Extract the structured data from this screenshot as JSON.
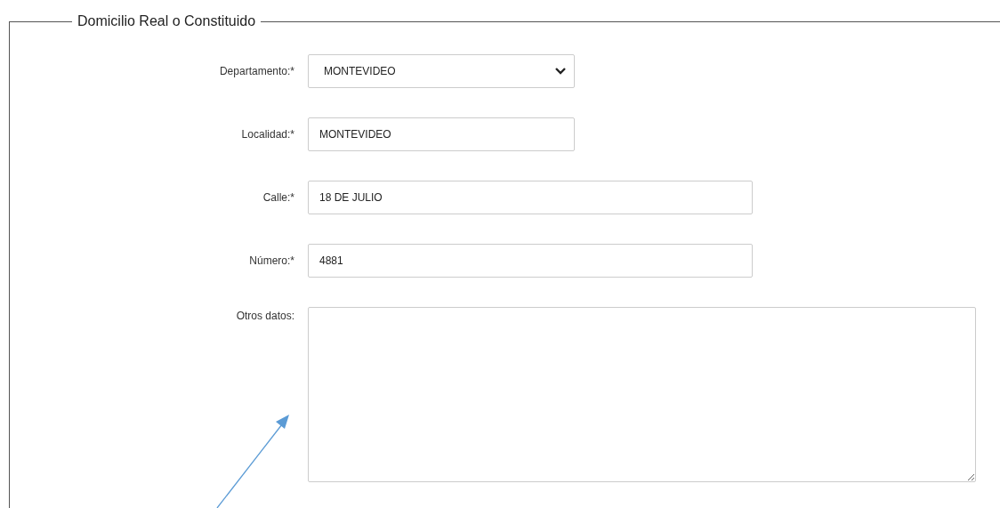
{
  "fieldset": {
    "legend": "Domicilio Real o Constituido",
    "fields": [
      {
        "kind": "select",
        "label": "Departamento:*",
        "value": "MONTEVIDEO"
      },
      {
        "kind": "input",
        "label": "Localidad:*",
        "value": "MONTEVIDEO"
      },
      {
        "kind": "input",
        "label": "Calle:*",
        "value": "18 DE JULIO"
      },
      {
        "kind": "input",
        "label": "Número:*",
        "value": "4881"
      },
      {
        "kind": "textarea",
        "label": "Otros datos:"
      }
    ]
  }
}
